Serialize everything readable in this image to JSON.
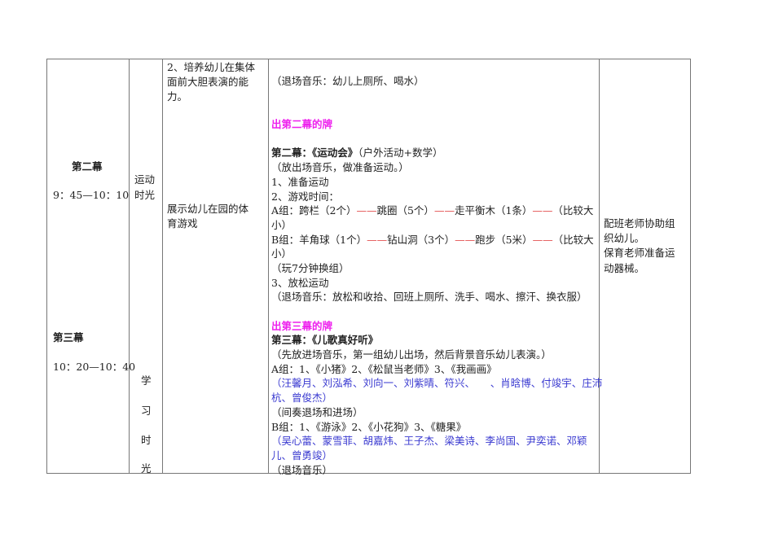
{
  "col1": {
    "act2_title": "第二幕",
    "act2_time": "9：45—10：10",
    "act3_title": "第三幕",
    "act3_time": "10：20—10：40"
  },
  "col2": {
    "sport_1": "运动",
    "sport_2": "时光",
    "study": [
      "学",
      "习",
      "时",
      "光"
    ]
  },
  "col3": {
    "goal_lines": [
      "2、培养幼儿在集体",
      "面前大胆表演的能",
      "力。"
    ],
    "show_lines": [
      "展示幼儿在园的体",
      "育游戏"
    ]
  },
  "col4": {
    "exit_music_1": "（退场音乐：幼儿上厕所、喝水）",
    "card2": "出第二幕的牌",
    "act2_heading": "第二幕：《运动会》",
    "act2_sub": "（户外活动+数学）",
    "act2_lines": [
      "（放出场音乐，做准备运动。）",
      "1、准备运动",
      "2、游戏时间："
    ],
    "groupA": [
      "A组：跨栏（2个）",
      "——",
      "跳圈（5个）",
      "——",
      "走平衡木（1条）",
      "——",
      "（比较大"
    ],
    "groupA_end": "小）",
    "groupB": [
      "B组：羊角球（1个）",
      "——",
      "钻山洞（3个）",
      "——",
      "跑步（5米）",
      "——",
      "（比较大"
    ],
    "groupB_end": "小）",
    "act2_tail": [
      "（玩7分钟换组）",
      "3、放松运动",
      "（退场音乐：放松和收拾、回班上厕所、洗手、喝水、擦汗、换衣服）"
    ],
    "card3": "出第三幕的牌",
    "act3_heading": "第三幕：《儿歌真好听》",
    "act3_intro": "（先放进场音乐，第一组幼儿出场，然后背景音乐幼儿表演。）",
    "a_songs": "A组：1、《小猪》2、《松鼠当老师》3、《我画画》",
    "a_names": [
      "（汪馨月、刘泓希、刘向一、刘紫晴、符兴、　　、肖晗博、付竣宇、庄沛",
      "杭、曾俊杰）"
    ],
    "interlude": "（间奏退场和进场）",
    "b_songs": "B组：1、《游泳》2、《小花狗》3、《糖果》",
    "b_names": [
      "（吴心蕾、蒙雪菲、胡嘉炜、王子杰、梁美诗、李尚国、尹奕诺、邓颖",
      "儿、曾勇竣）"
    ],
    "exit_music_3": "（退场音乐）"
  },
  "col5": {
    "lines": [
      "配班老师协助组",
      "织幼儿。",
      "保育老师准备运",
      "动器械。"
    ]
  },
  "colors": {
    "magenta": "#ee22ee",
    "blue": "#3a3ad0",
    "red": "#e04040"
  }
}
